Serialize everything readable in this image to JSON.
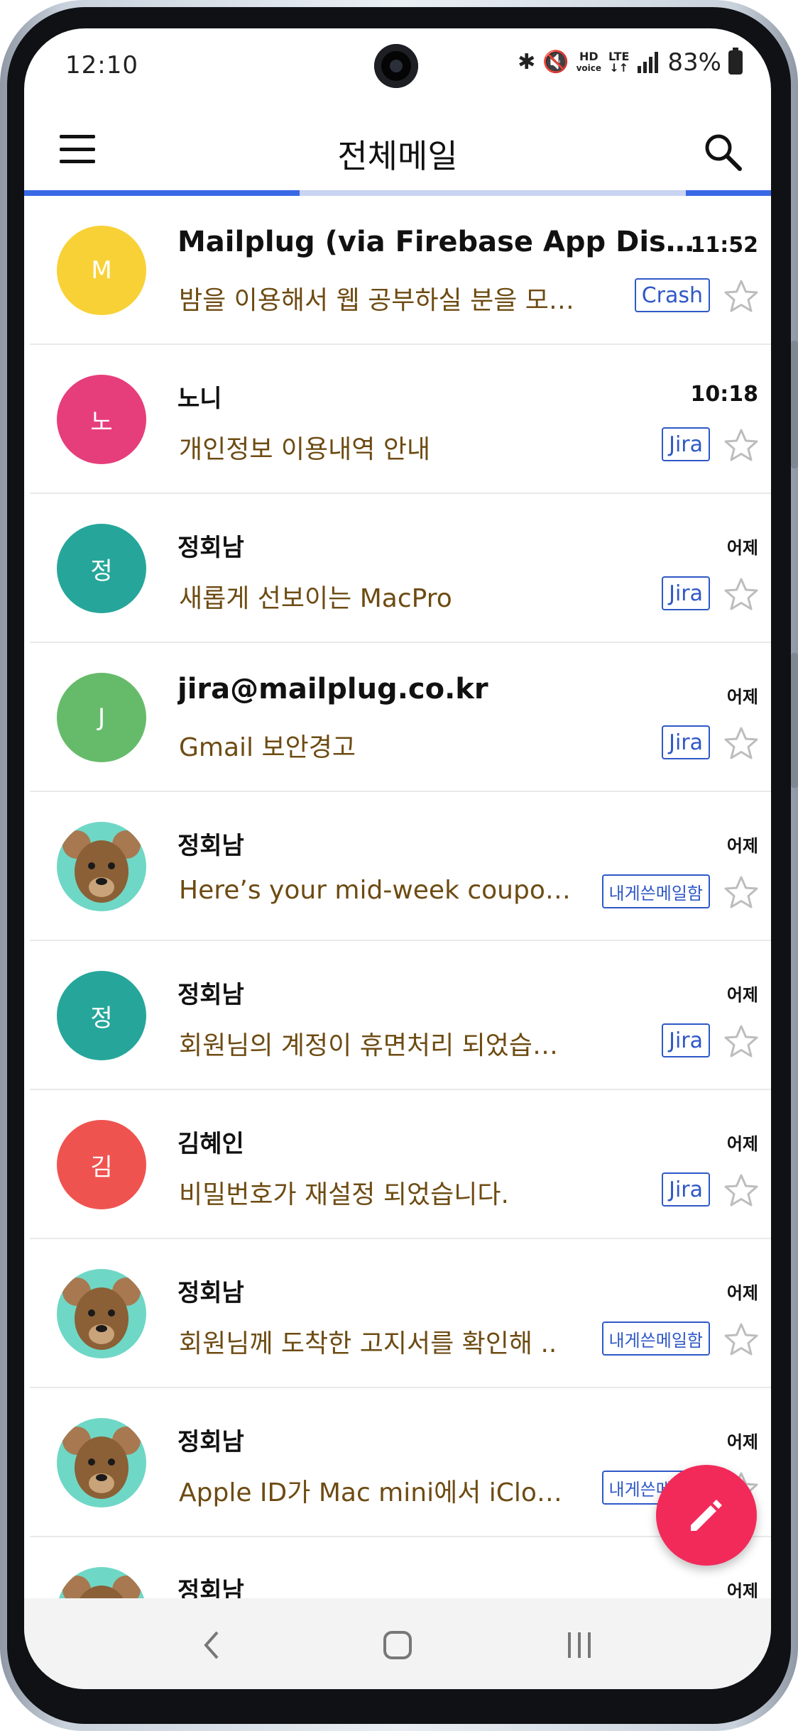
{
  "status_bar": {
    "time": "12:10",
    "hd_label": "HD",
    "voice_label": "voice",
    "lte_label": "LTE",
    "battery_percent": "83%"
  },
  "header": {
    "title": "전체메일",
    "menu_icon": "hamburger-icon",
    "search_icon": "search-icon"
  },
  "colors": {
    "accent": "#3868e6",
    "fab": "#f22a5a",
    "subject": "#6d4b12",
    "tag_border": "#2f58c7"
  },
  "emails": [
    {
      "sender": "Mailplug (via Firebase App Distri...",
      "initial": "M",
      "avatar_color": "#f8d136",
      "date": "11:52",
      "subject": "밤을 이용해서 웹 공부하실 분을 모집..",
      "tag": "Crash"
    },
    {
      "sender": "노니",
      "initial": "노",
      "avatar_color": "#e63e7b",
      "date": "10:18",
      "subject": "개인정보 이용내역 안내",
      "tag": "Jira"
    },
    {
      "sender": "정회남",
      "initial": "정",
      "avatar_color": "#26a69a",
      "date": "어제",
      "subject": "새롭게 선보이는 MacPro",
      "tag": "Jira"
    },
    {
      "sender": "jira@mailplug.co.kr",
      "initial": "J",
      "avatar_color": "#66bb6a",
      "date": "어제",
      "subject": "Gmail 보안경고",
      "tag": "Jira"
    },
    {
      "sender": "정회남",
      "initial": "",
      "avatar_color": "photo",
      "date": "어제",
      "subject": "Here’s your mid-week coupon, ..",
      "tag": "내게쓴메일함"
    },
    {
      "sender": "정회남",
      "initial": "정",
      "avatar_color": "#26a69a",
      "date": "어제",
      "subject": "회원님의 계정이 휴면처리 되었습니다.",
      "tag": "Jira"
    },
    {
      "sender": "김혜인",
      "initial": "김",
      "avatar_color": "#ef5350",
      "date": "어제",
      "subject": "비밀번호가 재설정 되었습니다.",
      "tag": "Jira"
    },
    {
      "sender": "정회남",
      "initial": "",
      "avatar_color": "photo",
      "date": "어제",
      "subject": "회원님께 도착한 고지서를 확인해 ..",
      "tag": "내게쓴메일함"
    },
    {
      "sender": "정회남",
      "initial": "",
      "avatar_color": "photo",
      "date": "어제",
      "subject": "Apple ID가 Mac mini에서 iCloud ..",
      "tag": "내게쓴메일함"
    },
    {
      "sender": "정회남",
      "initial": "",
      "avatar_color": "photo",
      "date": "어제",
      "subject": "",
      "tag": ""
    }
  ],
  "fab": {
    "icon": "pencil-icon"
  },
  "nav": {
    "back_icon": "back-icon",
    "home_icon": "home-icon",
    "recents_icon": "recents-icon"
  }
}
